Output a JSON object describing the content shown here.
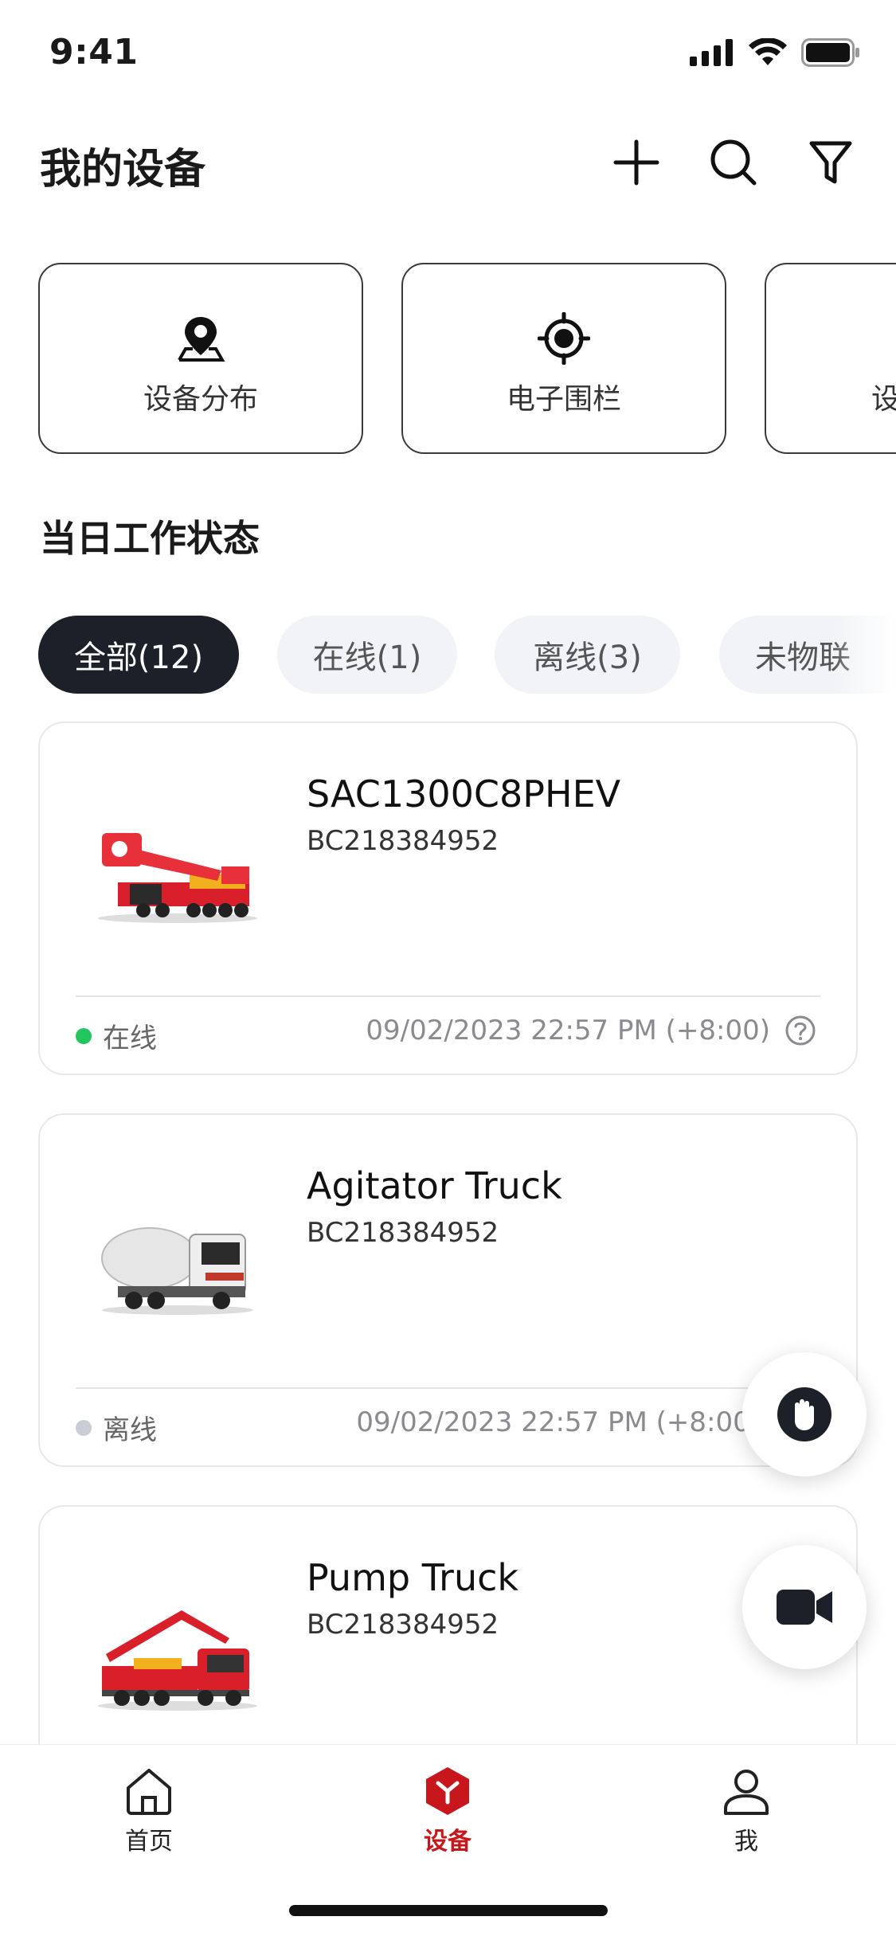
{
  "status_bar": {
    "time": "9:41"
  },
  "header": {
    "title": "我的设备",
    "add_icon": "plus-icon",
    "search_icon": "search-icon",
    "filter_icon": "filter-icon"
  },
  "quick_actions": [
    {
      "label": "设备分布",
      "icon": "location-pin-icon"
    },
    {
      "label": "电子围栏",
      "icon": "target-icon"
    },
    {
      "label": "设",
      "icon": "partial-card"
    }
  ],
  "section": {
    "title": "当日工作状态"
  },
  "tabs": [
    {
      "label": "全部(12)",
      "active": true
    },
    {
      "label": "在线(1)",
      "active": false
    },
    {
      "label": "离线(3)",
      "active": false
    },
    {
      "label": "未物联",
      "active": false
    }
  ],
  "devices": [
    {
      "name": "SAC1300C8PHEV",
      "serial": "BC218384952",
      "status": "在线",
      "status_color": "#22c55e",
      "time": "09/02/2023 22:57 PM (+8:00)",
      "image": "crane-truck-image"
    },
    {
      "name": "Agitator Truck",
      "serial": "BC218384952",
      "status": "离线",
      "status_color": "#c9cdd4",
      "time": "09/02/2023 22:57 PM (+8:00)",
      "image": "mixer-truck-image"
    },
    {
      "name": "Pump Truck",
      "serial": "BC218384952",
      "status": "",
      "status_color": "",
      "time": "",
      "image": "pump-truck-image"
    }
  ],
  "fabs": {
    "hand_icon": "hand-stop-icon",
    "video_icon": "video-camera-icon"
  },
  "bottom_nav": [
    {
      "label": "首页",
      "icon": "home-icon",
      "active": false
    },
    {
      "label": "设备",
      "icon": "device-cube-icon",
      "active": true
    },
    {
      "label": "我",
      "icon": "user-icon",
      "active": false
    }
  ],
  "colors": {
    "accent": "#c8161d",
    "dark": "#1d2028",
    "online": "#22c55e",
    "offline": "#c9cdd4"
  }
}
